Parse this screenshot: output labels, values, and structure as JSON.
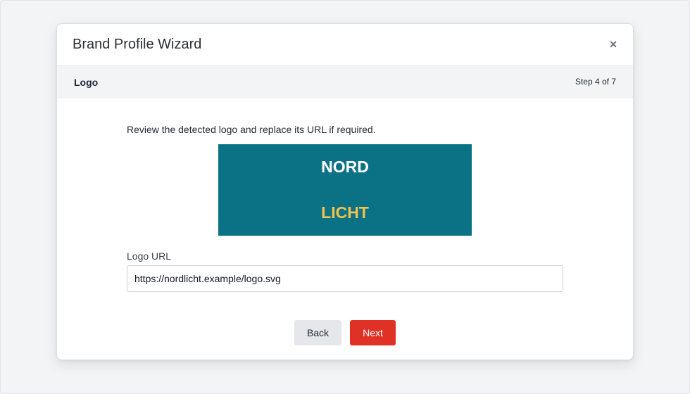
{
  "dialog": {
    "title": "Brand Profile Wizard",
    "close_label": "×"
  },
  "step": {
    "name": "Logo",
    "progress": "Step 4 of 7"
  },
  "content": {
    "instruction": "Review the detected logo and replace its URL if required.",
    "logo_preview": {
      "line1": "NORD",
      "line2": "LICHT",
      "background_color": "#0b7285",
      "line1_color": "#ffffff",
      "line2_color": "#f2c14e"
    },
    "logo_url_label": "Logo URL",
    "logo_url_value": "https://nordlicht.example/logo.svg"
  },
  "actions": {
    "back_label": "Back",
    "next_label": "Next",
    "next_color": "#e03127"
  }
}
